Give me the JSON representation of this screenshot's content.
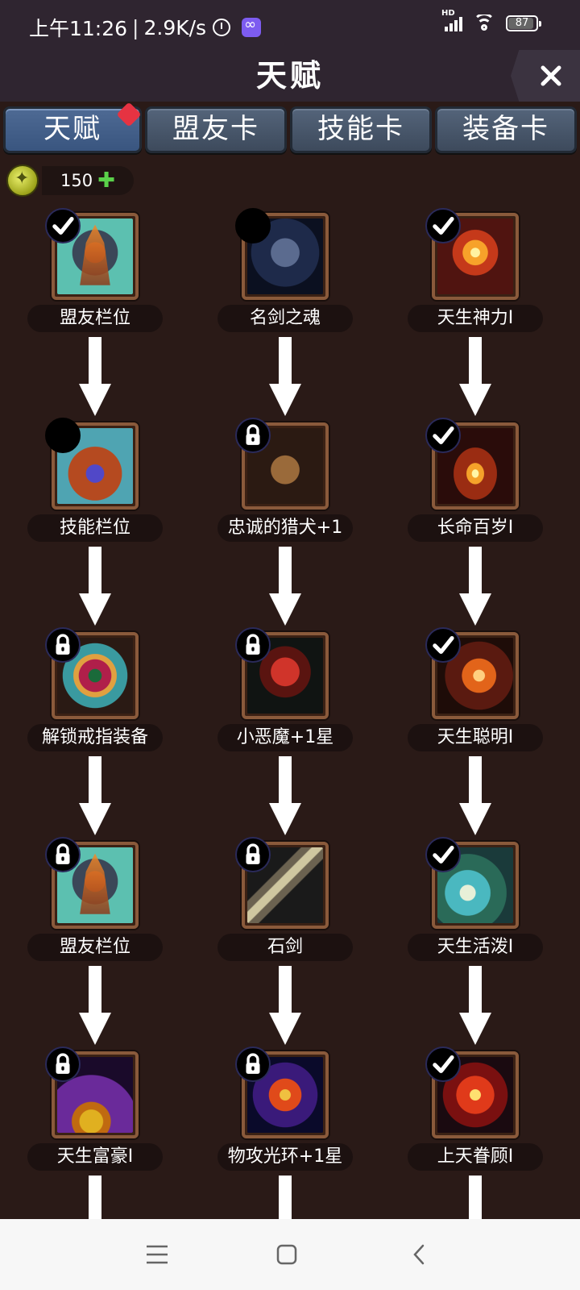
{
  "status_bar": {
    "time": "上午11:26",
    "net_speed": "2.9K/s",
    "battery": "87",
    "icons": [
      "alarm-icon",
      "app-icon",
      "hd-signal-icon",
      "wifi-icon",
      "battery-icon"
    ]
  },
  "header": {
    "title": "天赋",
    "close_icon": "close-icon"
  },
  "tabs": [
    {
      "label": "天赋",
      "active": true,
      "badge": true
    },
    {
      "label": "盟友卡",
      "active": false
    },
    {
      "label": "技能卡",
      "active": false
    },
    {
      "label": "装备卡",
      "active": false
    }
  ],
  "currency": {
    "amount": "150",
    "icon": "talent-point-icon",
    "add_icon": "plus-icon"
  },
  "talents": {
    "col1": [
      {
        "label": "盟友栏位",
        "state": "checked"
      },
      {
        "label": "技能栏位",
        "state": "empty"
      },
      {
        "label": "解锁戒指装备",
        "state": "locked"
      },
      {
        "label": "盟友栏位",
        "state": "locked"
      },
      {
        "label": "天生富豪Ⅰ",
        "state": "locked"
      }
    ],
    "col2": [
      {
        "label": "名剑之魂",
        "state": "empty"
      },
      {
        "label": "忠诚的猎犬+1",
        "state": "locked"
      },
      {
        "label": "小恶魔+1星",
        "state": "locked"
      },
      {
        "label": "石剑",
        "state": "locked"
      },
      {
        "label": "物攻光环+1星",
        "state": "locked"
      }
    ],
    "col3": [
      {
        "label": "天生神力Ⅰ",
        "state": "checked"
      },
      {
        "label": "长命百岁Ⅰ",
        "state": "checked"
      },
      {
        "label": "天生聪明Ⅰ",
        "state": "checked"
      },
      {
        "label": "天生活泼Ⅰ",
        "state": "checked"
      },
      {
        "label": "上天眷顾Ⅰ",
        "state": "checked"
      }
    ]
  },
  "nav": {
    "menu_icon": "menu-icon",
    "home_icon": "home-icon",
    "back_icon": "back-icon"
  },
  "colors": {
    "background": "#2a1a17",
    "tab_blue": "#4e6a94",
    "badge_red": "#e63342",
    "frame_brown": "#8a5a3b"
  }
}
